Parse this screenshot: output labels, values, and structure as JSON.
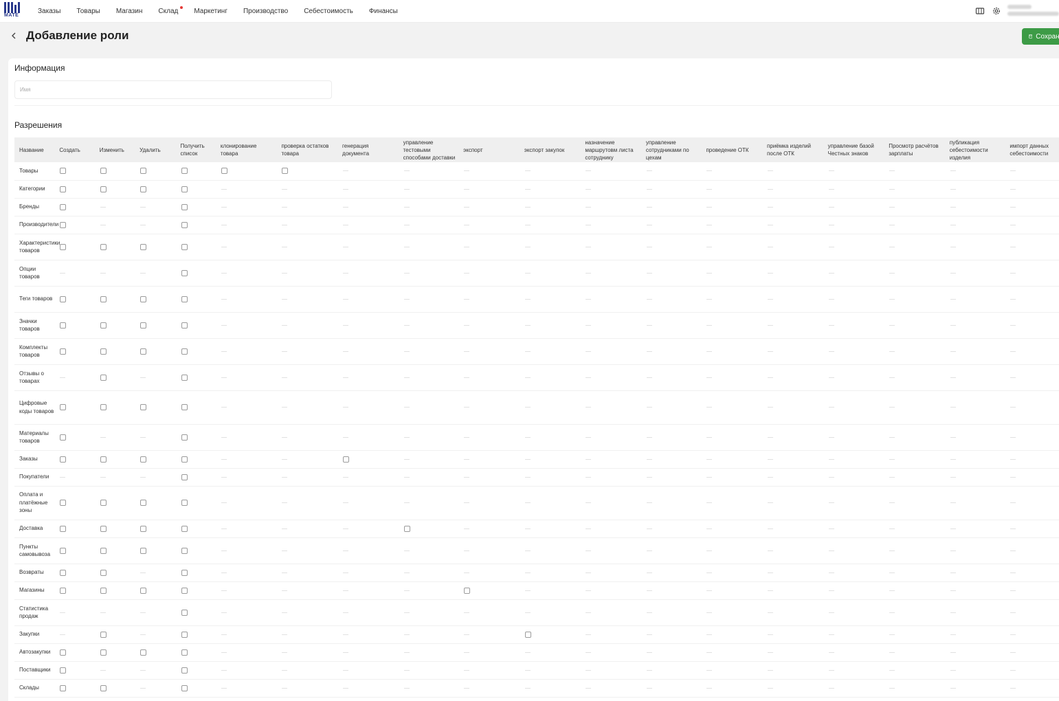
{
  "nav": {
    "items": [
      {
        "label": "Заказы",
        "dot": false
      },
      {
        "label": "Товары",
        "dot": false
      },
      {
        "label": "Магазин",
        "dot": false
      },
      {
        "label": "Склад",
        "dot": true
      },
      {
        "label": "Маркетинг",
        "dot": false
      },
      {
        "label": "Производство",
        "dot": false
      },
      {
        "label": "Себестоимость",
        "dot": false
      },
      {
        "label": "Финансы",
        "dot": false
      }
    ]
  },
  "logo": {
    "text": "MATE"
  },
  "header": {
    "title": "Добавление роли",
    "save_label": "Сохранить"
  },
  "info": {
    "title": "Информация",
    "name_placeholder": "Имя",
    "name_value": ""
  },
  "permissions": {
    "title": "Разрешения",
    "columns": [
      "Название",
      "Создать",
      "Изменить",
      "Удалить",
      "Получить список",
      "клонирование товара",
      "проверка остатков товара",
      "генерация документа",
      "управление тестовыми способами доставки",
      "экспорт",
      "экспорт закупок",
      "назначение маршрутовм листа сотруднику",
      "управление сотрудниками по цехам",
      "проведение ОТК",
      "приёмка изделий после ОТК",
      "управление базой Честных знаков",
      "Просмотр расчётов зарплаты",
      "публикация себестоимости изделия",
      "импорт данных себестоимости"
    ],
    "rows": [
      {
        "name": "Товары",
        "cells": [
          1,
          1,
          1,
          1,
          1,
          1,
          0,
          0,
          0,
          0,
          0,
          0,
          0,
          0,
          0,
          0,
          0,
          0
        ]
      },
      {
        "name": "Категории",
        "cells": [
          1,
          1,
          1,
          1,
          0,
          0,
          0,
          0,
          0,
          0,
          0,
          0,
          0,
          0,
          0,
          0,
          0,
          0
        ]
      },
      {
        "name": "Бренды",
        "cells": [
          1,
          0,
          0,
          1,
          0,
          0,
          0,
          0,
          0,
          0,
          0,
          0,
          0,
          0,
          0,
          0,
          0,
          0
        ]
      },
      {
        "name": "Производители",
        "cells": [
          1,
          0,
          0,
          1,
          0,
          0,
          0,
          0,
          0,
          0,
          0,
          0,
          0,
          0,
          0,
          0,
          0,
          0
        ]
      },
      {
        "name": "Характеристики товаров",
        "cells": [
          1,
          1,
          1,
          1,
          0,
          0,
          0,
          0,
          0,
          0,
          0,
          0,
          0,
          0,
          0,
          0,
          0,
          0
        ]
      },
      {
        "name": "Опции товаров",
        "cells": [
          0,
          0,
          0,
          1,
          0,
          0,
          0,
          0,
          0,
          0,
          0,
          0,
          0,
          0,
          0,
          0,
          0,
          0
        ]
      },
      {
        "name": "Теги товаров",
        "cells": [
          1,
          1,
          1,
          1,
          0,
          0,
          0,
          0,
          0,
          0,
          0,
          0,
          0,
          0,
          0,
          0,
          0,
          0
        ]
      },
      {
        "name": "Значки товаров",
        "cells": [
          1,
          1,
          1,
          1,
          0,
          0,
          0,
          0,
          0,
          0,
          0,
          0,
          0,
          0,
          0,
          0,
          0,
          0
        ]
      },
      {
        "name": "Комплекты товаров",
        "cells": [
          1,
          1,
          1,
          1,
          0,
          0,
          0,
          0,
          0,
          0,
          0,
          0,
          0,
          0,
          0,
          0,
          0,
          0
        ]
      },
      {
        "name": "Отзывы о товарах",
        "cells": [
          0,
          1,
          0,
          1,
          0,
          0,
          0,
          0,
          0,
          0,
          0,
          0,
          0,
          0,
          0,
          0,
          0,
          0
        ]
      },
      {
        "name": "Цифровые коды товаров",
        "cells": [
          1,
          1,
          1,
          1,
          0,
          0,
          0,
          0,
          0,
          0,
          0,
          0,
          0,
          0,
          0,
          0,
          0,
          0
        ]
      },
      {
        "name": "Материалы товаров",
        "cells": [
          1,
          0,
          0,
          1,
          0,
          0,
          0,
          0,
          0,
          0,
          0,
          0,
          0,
          0,
          0,
          0,
          0,
          0
        ]
      },
      {
        "name": "Заказы",
        "cells": [
          1,
          1,
          1,
          1,
          0,
          0,
          1,
          0,
          0,
          0,
          0,
          0,
          0,
          0,
          0,
          0,
          0,
          0
        ]
      },
      {
        "name": "Покупатели",
        "cells": [
          0,
          0,
          0,
          1,
          0,
          0,
          0,
          0,
          0,
          0,
          0,
          0,
          0,
          0,
          0,
          0,
          0,
          0
        ]
      },
      {
        "name": "Оплата и платёжные зоны",
        "cells": [
          1,
          1,
          1,
          1,
          0,
          0,
          0,
          0,
          0,
          0,
          0,
          0,
          0,
          0,
          0,
          0,
          0,
          0
        ]
      },
      {
        "name": "Доставка",
        "cells": [
          1,
          1,
          1,
          1,
          0,
          0,
          0,
          1,
          0,
          0,
          0,
          0,
          0,
          0,
          0,
          0,
          0,
          0
        ]
      },
      {
        "name": "Пункты самовывоза",
        "cells": [
          1,
          1,
          1,
          1,
          0,
          0,
          0,
          0,
          0,
          0,
          0,
          0,
          0,
          0,
          0,
          0,
          0,
          0
        ]
      },
      {
        "name": "Возвраты",
        "cells": [
          1,
          1,
          0,
          1,
          0,
          0,
          0,
          0,
          0,
          0,
          0,
          0,
          0,
          0,
          0,
          0,
          0,
          0
        ]
      },
      {
        "name": "Магазины",
        "cells": [
          1,
          1,
          1,
          1,
          0,
          0,
          0,
          0,
          1,
          0,
          0,
          0,
          0,
          0,
          0,
          0,
          0,
          0
        ]
      },
      {
        "name": "Статистика продаж",
        "cells": [
          0,
          0,
          0,
          1,
          0,
          0,
          0,
          0,
          0,
          0,
          0,
          0,
          0,
          0,
          0,
          0,
          0,
          0
        ]
      },
      {
        "name": "Закупки",
        "cells": [
          0,
          1,
          0,
          1,
          0,
          0,
          0,
          0,
          0,
          1,
          0,
          0,
          0,
          0,
          0,
          0,
          0,
          0
        ]
      },
      {
        "name": "Автозакупки",
        "cells": [
          1,
          1,
          1,
          1,
          0,
          0,
          0,
          0,
          0,
          0,
          0,
          0,
          0,
          0,
          0,
          0,
          0,
          0
        ]
      },
      {
        "name": "Поставщики",
        "cells": [
          1,
          0,
          0,
          1,
          0,
          0,
          0,
          0,
          0,
          0,
          0,
          0,
          0,
          0,
          0,
          0,
          0,
          0
        ]
      },
      {
        "name": "Склады",
        "cells": [
          1,
          1,
          0,
          1,
          0,
          0,
          0,
          0,
          0,
          0,
          0,
          0,
          0,
          0,
          0,
          0,
          0,
          0
        ]
      }
    ]
  },
  "colors": {
    "accent": "#3d9b46",
    "logo": "#2a3a8c",
    "nav_dot": "#e53935"
  }
}
